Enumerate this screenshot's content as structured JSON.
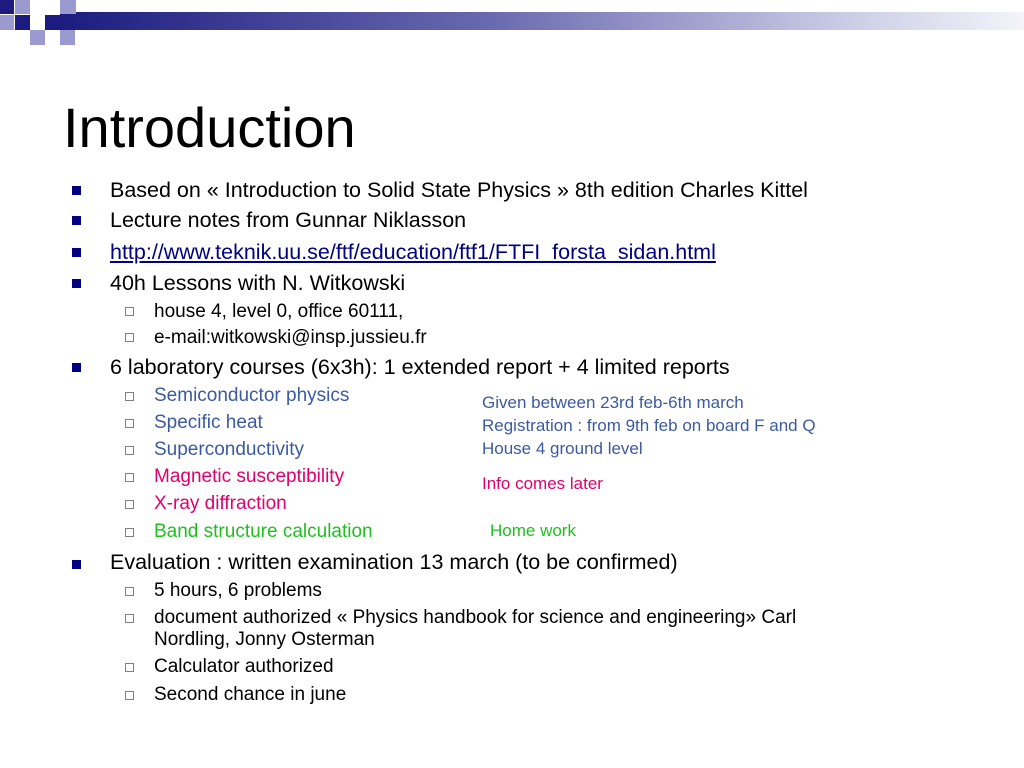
{
  "slide": {
    "title": "Introduction",
    "colors": {
      "bullet": "#000080",
      "link": "#000080",
      "blue_text": "#3b5aa0",
      "pink_text": "#e0006d",
      "green_text": "#1fbf1f",
      "deco_dark": "#1c1c80",
      "deco_light": "#9a9ad0"
    },
    "bullets": [
      {
        "text": "Based on « Introduction to Solid State Physics » 8th edition Charles Kittel"
      },
      {
        "text": "Lecture notes from Gunnar Niklasson"
      },
      {
        "text": "http://www.teknik.uu.se/ftf/education/ftf1/FTFI_forsta_sidan.html",
        "is_link": true
      },
      {
        "text": "40h Lessons with N. Witkowski",
        "sub": [
          {
            "text": "house 4, level 0, office 60111,"
          },
          {
            "text": "e-mail:witkowski@insp.jussieu.fr"
          }
        ]
      },
      {
        "text": "6 laboratory courses (6x3h): 1 extended report + 4 limited reports",
        "sub": [
          {
            "text": "Semiconductor physics",
            "color": "#3b5aa0"
          },
          {
            "text": "Specific heat",
            "color": "#3b5aa0"
          },
          {
            "text": "Superconductivity",
            "color": "#3b5aa0"
          },
          {
            "text": "Magnetic susceptibility",
            "color": "#e0006d"
          },
          {
            "text": "X-ray diffraction",
            "color": "#e0006d"
          },
          {
            "text": "Band structure calculation",
            "color": "#1fbf1f"
          }
        ]
      },
      {
        "text": "Evaluation : written examination 13 march (to be confirmed)",
        "sub": [
          {
            "text": "5 hours, 6 problems"
          },
          {
            "text": "document authorized « Physics handbook for science and engineering» Carl",
            "cont": "Nordling, Jonny Osterman"
          },
          {
            "text": "Calculator authorized"
          },
          {
            "text": "Second chance in june"
          }
        ]
      }
    ],
    "notes": {
      "blue": [
        "Given between 23rd feb-6th march",
        "Registration : from 9th feb on board F and Q",
        "House 4 ground level"
      ],
      "pink": "Info comes later",
      "green": "Home work"
    }
  }
}
